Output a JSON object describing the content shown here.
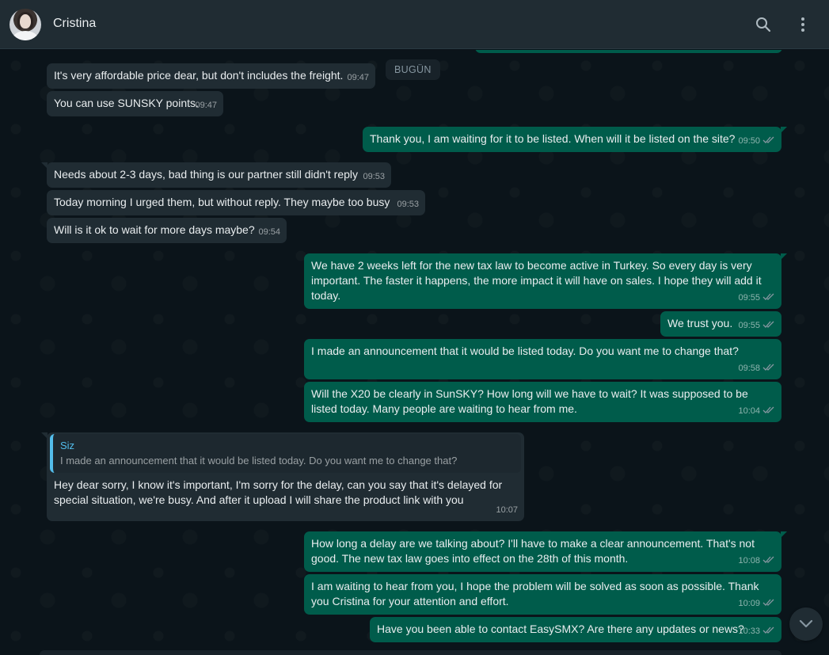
{
  "header": {
    "contact_name": "Cristina",
    "search_icon": "search-icon",
    "menu_icon": "kebab-menu-icon"
  },
  "date_chip": "BUGÜN",
  "messages": [
    {
      "dir": "in",
      "text": "It's very affordable price dear, but don't includes the freight.",
      "time": "09:47"
    },
    {
      "dir": "in",
      "text": "You can use SUNSKY points.",
      "time": "09:47"
    },
    {
      "dir": "out",
      "text": "Thank you, I am waiting for it to be listed. When will it be listed on the site?",
      "time": "09:50"
    },
    {
      "dir": "in",
      "text": "Needs about 2-3 days, bad thing is our partner still didn't reply",
      "time": "09:53"
    },
    {
      "dir": "in",
      "text": "Today morning I urged them, but without reply. They maybe too busy",
      "time": "09:53"
    },
    {
      "dir": "in",
      "text": "Will is it ok to wait for more days maybe?",
      "time": "09:54"
    },
    {
      "dir": "out",
      "text": "We have 2 weeks left for the new tax law to become active in Turkey. So every day is very important. The faster it happens, the more impact it will have on sales. I hope they will add it today.",
      "time": "09:55"
    },
    {
      "dir": "out",
      "text": "We trust you.",
      "time": "09:55"
    },
    {
      "dir": "out",
      "text": "I made an announcement that it would be listed today. Do you want me to change that?",
      "time": "09:58"
    },
    {
      "dir": "out",
      "text": "Will the X20 be clearly in SunSKY? How long will we have to wait? It was supposed to be listed today. Many people are waiting to hear from me.",
      "time": "10:04"
    },
    {
      "dir": "in",
      "quote_author": "Siz",
      "quote_text": "I made an announcement that it would be listed today. Do you want me to change that?",
      "text": "Hey dear sorry, I know it's important, I'm sorry for the delay, can you say that it's delayed for special situation, we're busy. And after it upload  I will share the product link with you",
      "time": "10:07"
    },
    {
      "dir": "out",
      "text": "How long a delay are we talking about? I'll have to make a clear announcement. That's not good. The new tax law goes into effect on the 28th of this month.",
      "time": "10:08"
    },
    {
      "dir": "out",
      "text": "I am waiting to hear from you, I hope the problem will be solved as soon as possible. Thank you Cristina for your attention and effort.",
      "time": "10:09"
    },
    {
      "dir": "out",
      "text": "Have you been able to contact EasySMX? Are there any updates or news?",
      "time": "10:33"
    }
  ],
  "scroll_button_icon": "chevron-down-icon",
  "colors": {
    "incoming_bubble": "#202c33",
    "outgoing_bubble": "#005c4b",
    "background": "#0b141a",
    "header": "#202c33",
    "read_ticks": "#8696a0",
    "quote_accent": "#53bdeb"
  }
}
